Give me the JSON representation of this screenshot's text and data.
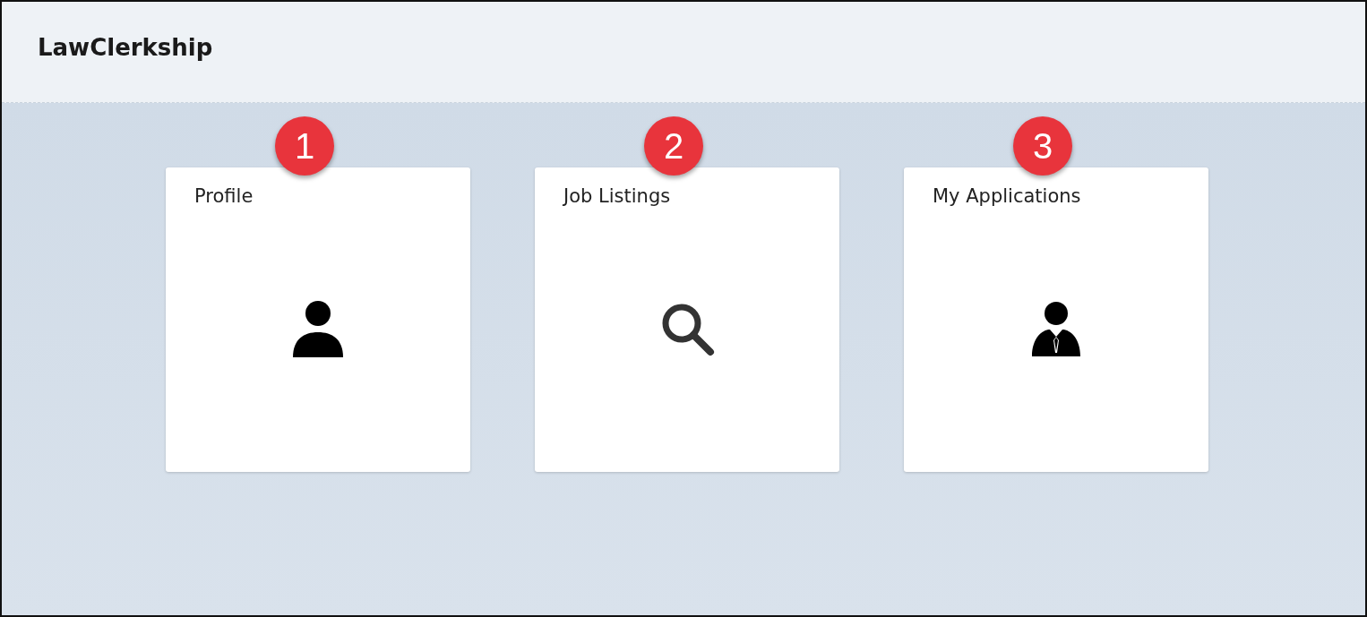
{
  "header": {
    "title": "LawClerkship"
  },
  "tiles": [
    {
      "badge": "1",
      "label": "Profile",
      "kind": "person"
    },
    {
      "badge": "2",
      "label": "Job Listings",
      "kind": "search"
    },
    {
      "badge": "3",
      "label": "My Applications",
      "kind": "businessman"
    }
  ]
}
